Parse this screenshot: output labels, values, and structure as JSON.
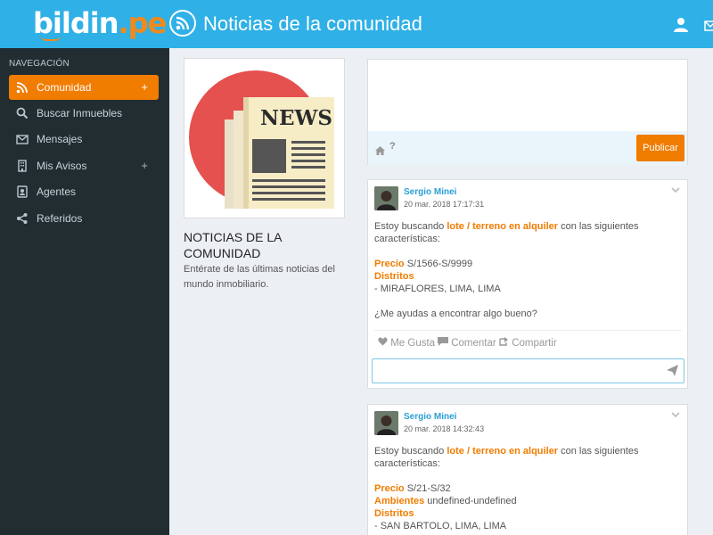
{
  "header": {
    "logo_main": "bildin",
    "logo_dot": ".",
    "logo_tld": "pe",
    "page_icon": "rss-icon",
    "page_title": "Noticias de la comunidad",
    "user_icon": "user-icon",
    "mail_icon": "mail-icon"
  },
  "sidebar": {
    "heading": "NAVEGACIÓN",
    "items": [
      {
        "label": "Comunidad",
        "icon": "rss-icon",
        "active": true,
        "expandable": true
      },
      {
        "label": "Buscar Inmuebles",
        "icon": "search-icon",
        "active": false,
        "expandable": false
      },
      {
        "label": "Mensajes",
        "icon": "envelope-icon",
        "active": false,
        "expandable": false
      },
      {
        "label": "Mis Avisos",
        "icon": "building-icon",
        "active": false,
        "expandable": true
      },
      {
        "label": "Agentes",
        "icon": "id-card-icon",
        "active": false,
        "expandable": false
      },
      {
        "label": "Referidos",
        "icon": "share-icon",
        "active": false,
        "expandable": false
      }
    ],
    "expand_symbol": "+"
  },
  "info": {
    "news_word": "NEWS",
    "title": "NOTICIAS DE LA COMUNIDAD",
    "description": "Entérate de las últimas noticias del mundo inmobiliario."
  },
  "composer": {
    "textarea_value": "",
    "help_label": "?",
    "publish_label": "Publicar"
  },
  "posts": [
    {
      "author": "Sergio Minei",
      "date": "20 mar. 2018 17:17:31",
      "intro_pre": "Estoy buscando ",
      "intro_hl": "lote / terreno en alquiler",
      "intro_post": " con las siguientes características:",
      "price_label": "Precio",
      "price_value": " S/1566-S/9999",
      "districts_label": "Distritos",
      "district_value": "- MIRAFLORES, LIMA, LIMA",
      "question": "¿Me ayudas a encontrar algo bueno?",
      "like_label": "Me Gusta",
      "comment_label": "Comentar",
      "share_label": "Compartir",
      "comment_value": ""
    },
    {
      "author": "Sergio Minei",
      "date": "20 mar. 2018 14:32:43",
      "intro_pre": "Estoy buscando ",
      "intro_hl": "lote / terreno en alquiler",
      "intro_post": " con las siguientes características:",
      "price_label": "Precio",
      "price_value": " S/21-S/32",
      "rooms_label": "Ambientes",
      "rooms_value": " undefined-undefined",
      "districts_label": "Distritos",
      "district_value": "- SAN BARTOLO, LIMA, LIMA"
    }
  ],
  "colors": {
    "header_bg": "#2fb0e6",
    "sidebar_bg": "#222d32",
    "accent": "#f07c00",
    "author_link": "#2a9fd6",
    "page_bg": "#ecf0f5"
  }
}
